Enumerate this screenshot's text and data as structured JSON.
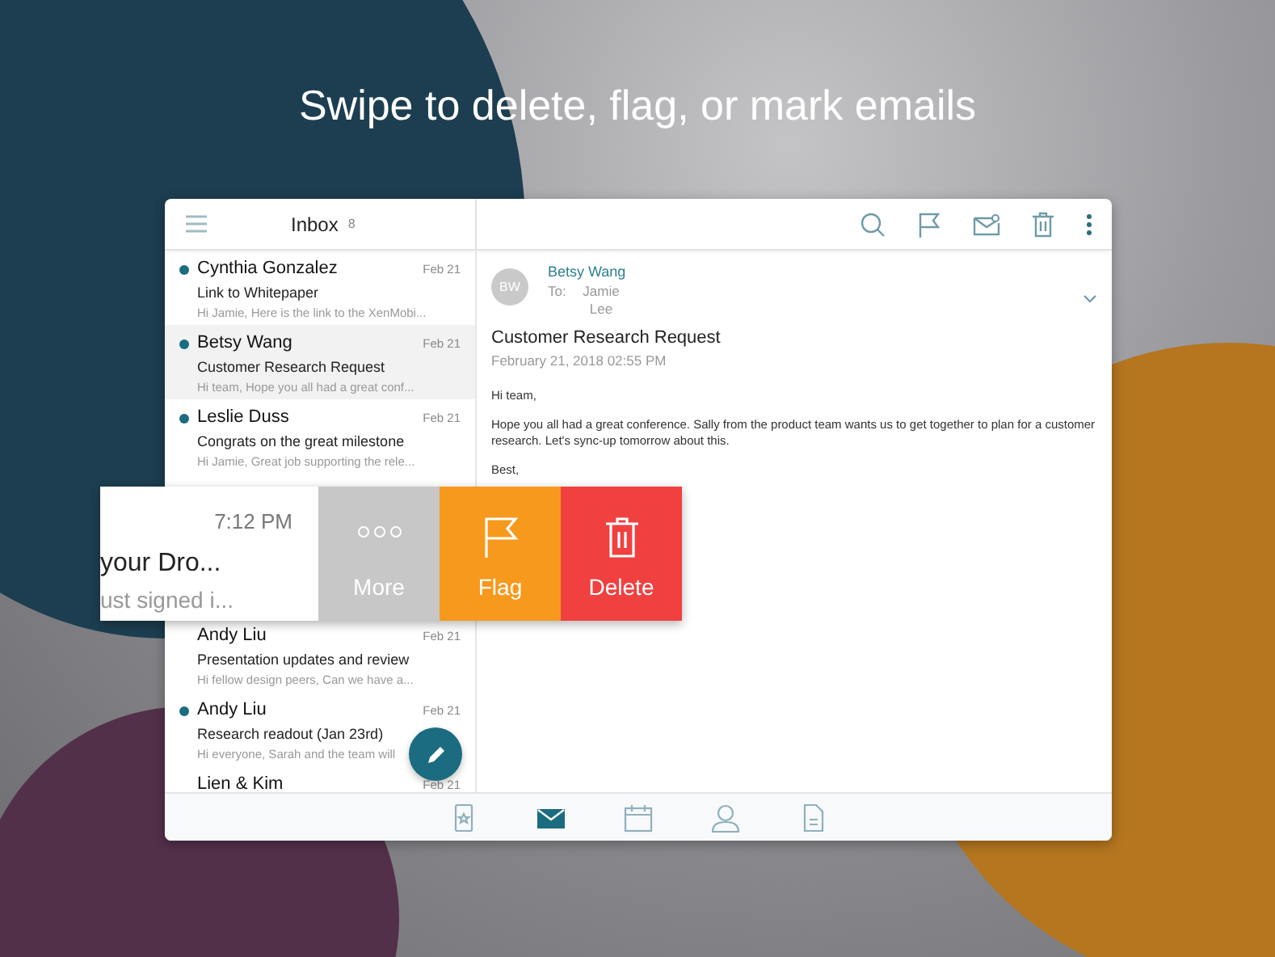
{
  "headline": "Swipe to delete, flag, or mark emails",
  "inbox": {
    "title": "Inbox",
    "count": "8"
  },
  "emails_above": [
    {
      "name": "Cynthia Gonzalez",
      "date": "Feb 21",
      "subject": "Link to Whitepaper",
      "preview": "Hi Jamie, Here is the link to the XenMobi...",
      "unread": true,
      "selected": false
    },
    {
      "name": "Betsy Wang",
      "date": "Feb 21",
      "subject": "Customer Research Request",
      "preview": "Hi team, Hope you all had a great conf...",
      "unread": true,
      "selected": true
    },
    {
      "name": "Leslie Duss",
      "date": "Feb 21",
      "subject": "Congrats on the great milestone",
      "preview": "Hi Jamie, Great job supporting the rele...",
      "unread": true,
      "selected": false
    }
  ],
  "swiped_email": {
    "time": "7:12 PM",
    "subject": "your Dro...",
    "preview": "ust signed i...",
    "actions": [
      {
        "kind": "more",
        "label": "More"
      },
      {
        "kind": "flag",
        "label": "Flag"
      },
      {
        "kind": "delete",
        "label": "Delete"
      }
    ]
  },
  "emails_below": [
    {
      "name": "Andy Liu",
      "date": "Feb 21",
      "subject": "Presentation updates and review",
      "preview": "Hi fellow design peers, Can we have a...",
      "unread": false,
      "selected": false
    },
    {
      "name": "Andy Liu",
      "date": "Feb 21",
      "subject": "Research readout (Jan 23rd)",
      "preview": "Hi everyone, Sarah and the team will",
      "unread": true,
      "selected": false
    },
    {
      "name": "Lien & Kim",
      "date": "Feb 21",
      "unread": false,
      "selected": false
    }
  ],
  "message": {
    "avatar": "BW",
    "sender": "Betsy Wang",
    "to_label": "To:",
    "to": "Jamie Lee",
    "subject": "Customer Research Request",
    "date": "February 21, 2018 02:55 PM",
    "body": [
      "Hi team,",
      "Hope you all had a great conference. Sally from the product team wants us to get together to plan for a customer research. Let's sync-up tomorrow about this.",
      "Best,"
    ]
  },
  "bottom_nav": [
    {
      "kind": "today",
      "selected": false
    },
    {
      "kind": "mail",
      "selected": true
    },
    {
      "kind": "calendar",
      "selected": false
    },
    {
      "kind": "contacts",
      "selected": false
    },
    {
      "kind": "files",
      "selected": false
    }
  ]
}
